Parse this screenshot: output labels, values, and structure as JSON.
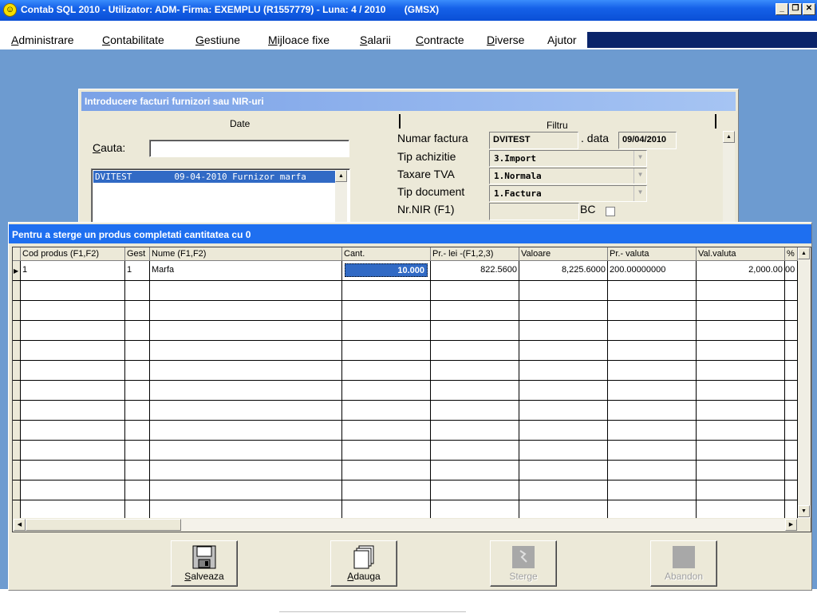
{
  "titlebar": {
    "app_icon": "smiley-icon",
    "title": "Contab SQL 2010 - Utilizator: ADM- Firma: EXEMPLU (R1557779) - Luna: 4 / 2010       (GMSX)"
  },
  "menu": [
    {
      "label": "Administrare",
      "hotkey": "A"
    },
    {
      "label": "Contabilitate",
      "hotkey": "C"
    },
    {
      "label": "Gestiune",
      "hotkey": "G"
    },
    {
      "label": "Mijloace fixe",
      "hotkey": "M"
    },
    {
      "label": "Salarii",
      "hotkey": "S"
    },
    {
      "label": "Contracte",
      "hotkey": "C"
    },
    {
      "label": "Diverse",
      "hotkey": "D"
    },
    {
      "label": "Ajutor",
      "hotkey": "j"
    }
  ],
  "invoice_dialog": {
    "title": "Introducere facturi furnizori sau NIR-uri",
    "tab_date": "Date",
    "tab_filtru": "Filtru",
    "search_label": "Cauta:",
    "search_value": "",
    "list_item": "DVITEST        09-04-2010 Furnizor marfa",
    "numar_factura_label": "Numar factura",
    "numar_factura": "DVITEST",
    "data_label": ". data",
    "data": "09/04/2010",
    "tip_achizitie_label": "Tip achizitie",
    "tip_achizitie": "3.Import",
    "taxare_tva_label": "Taxare TVA",
    "taxare_tva": "1.Normala",
    "tip_document_label": "Tip document",
    "tip_document": "1.Factura",
    "nr_nir_label": "Nr.NIR (F1)",
    "nr_nir": "",
    "bc_label": "BC"
  },
  "products_dialog": {
    "title": "Pentru a sterge un produs completati cantitatea cu 0",
    "columns": [
      "Cod produs (F1,F2)",
      "Gest",
      "Nume (F1,F2)",
      "Cant.",
      "Pr.- lei -(F1,2,3)",
      "Valoare",
      "Pr.- valuta",
      "Val.valuta",
      "%"
    ],
    "rows": [
      {
        "cod": "1",
        "gest": "1",
        "nume": "Marfa",
        "cant": "10.000",
        "pret_lei": "822.5600",
        "valoare": "8,225.6000",
        "pret_valuta": "200.00000000",
        "val_valuta": "2,000.00",
        "procent": "00"
      }
    ],
    "buttons": [
      {
        "label": "Salveaza",
        "hotkey": "S",
        "icon": "floppy-disk-icon",
        "enabled": true
      },
      {
        "label": "Adauga",
        "hotkey": "A",
        "icon": "new-document-icon",
        "enabled": true
      },
      {
        "label": "Sterge",
        "hotkey": "",
        "icon": "delete-icon",
        "enabled": false
      },
      {
        "label": "Abandon",
        "hotkey": "",
        "icon": "abandon-icon",
        "enabled": false
      }
    ]
  }
}
